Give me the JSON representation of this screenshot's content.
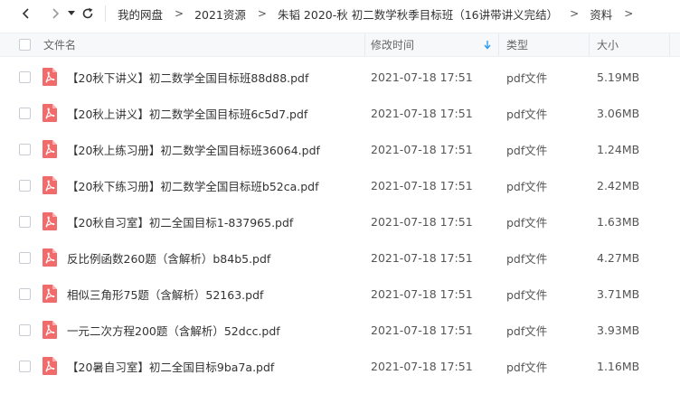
{
  "toolbar": {
    "back_icon": "chevron-left-icon",
    "forward_icon": "chevron-right-icon",
    "dropdown_icon": "caret-down-icon",
    "refresh_icon": "refresh-icon",
    "breadcrumbs": [
      "我的网盘",
      "2021资源",
      "朱韬 2020-秋 初二数学秋季目标班（16讲带讲义完结）",
      "资料"
    ],
    "separator": ">"
  },
  "table": {
    "headers": {
      "name": "文件名",
      "modified": "修改时间",
      "type": "类型",
      "size": "大小"
    },
    "sort_icon": "sort-down-arrow-icon",
    "sort_color": "#2e9bf0",
    "file_icon": "pdf-file-icon",
    "file_icon_color": "#f26b6b",
    "rows": [
      {
        "name": "【20秋下讲义】初二数学全国目标班88d88.pdf",
        "modified": "2021-07-18 17:51",
        "type": "pdf文件",
        "size": "5.19MB"
      },
      {
        "name": "【20秋上讲义】初二数学全国目标班6c5d7.pdf",
        "modified": "2021-07-18 17:51",
        "type": "pdf文件",
        "size": "3.06MB"
      },
      {
        "name": "【20秋上练习册】初二数学全国目标班36064.pdf",
        "modified": "2021-07-18 17:51",
        "type": "pdf文件",
        "size": "1.24MB"
      },
      {
        "name": "【20秋下练习册】初二数学全国目标班b52ca.pdf",
        "modified": "2021-07-18 17:51",
        "type": "pdf文件",
        "size": "2.42MB"
      },
      {
        "name": "【20秋自习室】初二全国目标1-837965.pdf",
        "modified": "2021-07-18 17:51",
        "type": "pdf文件",
        "size": "1.63MB"
      },
      {
        "name": "反比例函数260题（含解析）b84b5.pdf",
        "modified": "2021-07-18 17:51",
        "type": "pdf文件",
        "size": "4.27MB"
      },
      {
        "name": "相似三角形75题（含解析）52163.pdf",
        "modified": "2021-07-18 17:51",
        "type": "pdf文件",
        "size": "3.71MB"
      },
      {
        "name": "一元二次方程200题（含解析）52dcc.pdf",
        "modified": "2021-07-18 17:51",
        "type": "pdf文件",
        "size": "3.93MB"
      },
      {
        "name": "【20暑自习室】初二全国目标9ba7a.pdf",
        "modified": "2021-07-18 17:51",
        "type": "pdf文件",
        "size": "1.16MB"
      }
    ]
  }
}
